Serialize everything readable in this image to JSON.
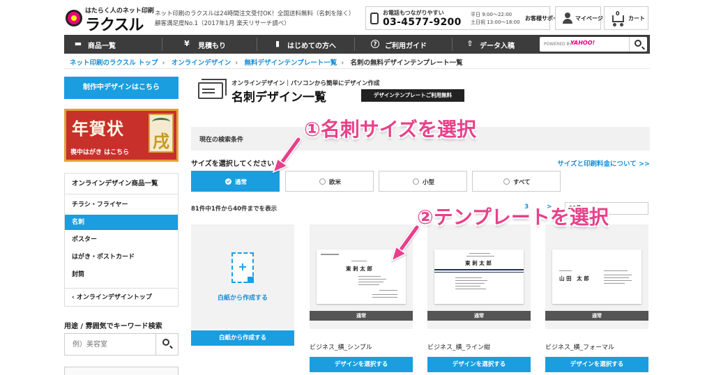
{
  "header": {
    "logo_top": "はたらく人のネット印刷",
    "logo_main": "ラクスル",
    "tagline_1": "ネット印刷のラクスルは24時間注文受付OK！全国送料無料（名刺を除く）",
    "tagline_2": "顧客満足度No.1（2017年1月 楽天リサーチ調べ）",
    "phone_caption": "お電話もつながりやすい",
    "phone_number": "03-4577-9200",
    "hours_weekday": "平日 9:00～22:00",
    "hours_weekend": "土日祝 13:00～18:00",
    "support_label": "お客様サポート",
    "mypage_label": "マイページ",
    "cart_label": "カート",
    "cart_count": "0"
  },
  "nav": {
    "items": [
      {
        "icon": "▬",
        "label": "商品一覧"
      },
      {
        "icon": "¥",
        "label": "見積もり"
      },
      {
        "icon": "▮",
        "label": "はじめての方へ"
      },
      {
        "icon": "?",
        "label": "ご利用ガイド"
      },
      {
        "icon": "⇧",
        "label": "データ入稿"
      }
    ],
    "search_placeholder": "POWERED BY",
    "search_brand": "YAHOO!"
  },
  "breadcrumb": {
    "items": [
      "ネット印刷のラクスル トップ",
      "オンラインデザイン",
      "無料デザインテンプレート一覧"
    ],
    "current": "名刺の無料デザインテンプレート一覧"
  },
  "sidebar": {
    "design_button": "制作中デザインはこちら",
    "banner_title": "年賀状",
    "banner_sub": "喪中はがき はこちら",
    "banner_card_char": "戌",
    "menu_title": "オンラインデザイン商品一覧",
    "menu_items": [
      "チラシ・フライヤー",
      "名刺",
      "ポスター",
      "はがき・ポストカード",
      "封筒"
    ],
    "menu_back": "オンラインデザイントップ",
    "keyword_label": "用途 / 雰囲気でキーワード検索",
    "keyword_placeholder": "例）美容室"
  },
  "main": {
    "eyebrow": "オンラインデザイン｜パソコンから簡単にデザイン作成",
    "title": "名刺デザイン一覧",
    "free_badge": "デザインテンプレートご利用無料",
    "conditions_label": "現在の検索条件",
    "size_label": "サイズを選択してください",
    "size_link": "サイズと印刷料金について >>",
    "sizes": [
      "通常",
      "欧米",
      "小型",
      "すべて"
    ],
    "selected_size": "通常",
    "result_count": "81件中1件から40件までを表示",
    "pager_current": "3",
    "pager_next": ">",
    "per_page": "40件",
    "blank_text": "白紙から作成する",
    "blank_button": "白紙から作成する",
    "templates": [
      {
        "name": "ビジネス_横_シンプル",
        "tag": "通常",
        "button": "デザインを選択する",
        "card_name": "東 刺 太 郎"
      },
      {
        "name": "ビジネス_横_ライン紺",
        "tag": "通常",
        "button": "デザインを選択する",
        "card_name": "東 刺 太 郎"
      },
      {
        "name": "ビジネス_横_フォーマル",
        "tag": "通常",
        "button": "デザインを選択する",
        "card_name": "山 田　太 郎"
      }
    ]
  },
  "annotations": {
    "step1": "①名刺サイズを選択",
    "step2": "②テンプレートを選択",
    "color": "#e8418a"
  },
  "colors": {
    "accent": "#1a9ee0",
    "nav_bg": "#3c3c3c",
    "link": "#1a8fd6"
  }
}
